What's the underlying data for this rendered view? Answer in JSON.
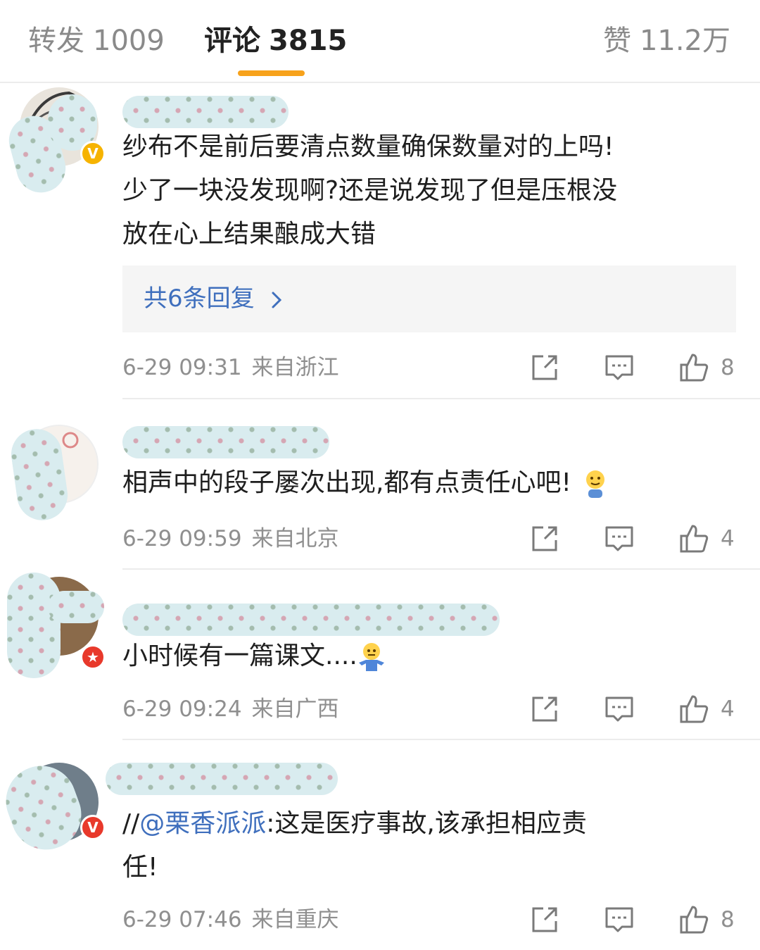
{
  "tabs": {
    "repost": {
      "label": "转发",
      "count": "1009"
    },
    "comments": {
      "label": "评论",
      "count": "3815"
    },
    "likes": {
      "label": "赞",
      "count": "11.2万"
    }
  },
  "colors": {
    "accent": "#f7a21b",
    "link": "#3f6fbd",
    "meta": "#8f8f8f",
    "scribble": "#d9ecef"
  },
  "comments": [
    {
      "username_redacted": true,
      "verified_badge": "gold",
      "text_lines": [
        "纱布不是前后要清点数量确保数量对的上吗!",
        "少了一块没发现啊?还是说发现了但是压根没",
        "放在心上结果酿成大错"
      ],
      "reply_summary": "共6条回复",
      "time": "6-29 09:31",
      "location": "来自浙江",
      "likes": "8"
    },
    {
      "username_redacted": true,
      "verified_badge": "",
      "text": "相声中的段子屡次出现,都有点责任心吧!",
      "emoji": "pray-emoji",
      "time": "6-29 09:59",
      "location": "来自北京",
      "likes": "4"
    },
    {
      "username_redacted": true,
      "verified_badge": "red",
      "text": "小时候有一篇课文....",
      "emoji": "shrug-emoji",
      "time": "6-29 09:24",
      "location": "来自广西",
      "likes": "4"
    },
    {
      "username_redacted": true,
      "verified_badge": "red",
      "prefix": "//",
      "mention": "@栗香派派",
      "text_lines": [
        ":这是医疗事故,该承担相应责",
        "任!"
      ],
      "time": "6-29 07:46",
      "location": "来自重庆",
      "likes": "8"
    }
  ]
}
